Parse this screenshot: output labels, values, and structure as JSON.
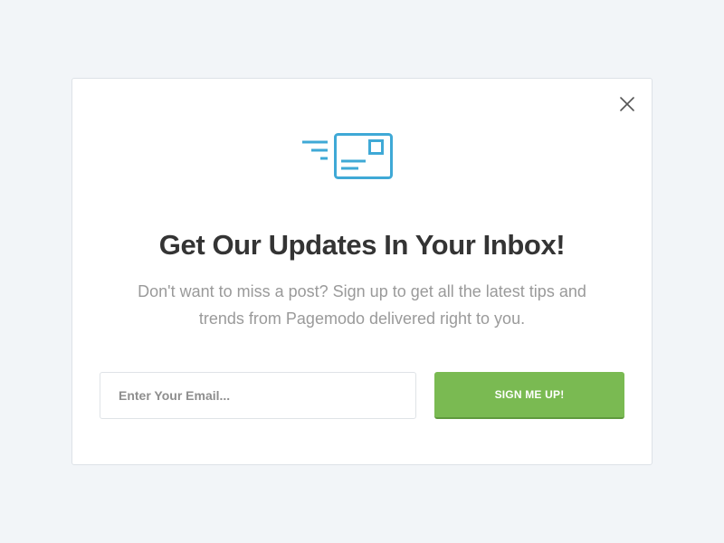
{
  "modal": {
    "title": "Get Our Updates In Your Inbox!",
    "subtitle": "Don't want to miss a post? Sign up to get all the latest tips and trends from Pagemodo delivered right to you.",
    "icon": "envelope-icon",
    "close_icon": "close-icon"
  },
  "form": {
    "email_placeholder": "Enter Your Email...",
    "email_value": "",
    "submit_label": "SIGN ME UP!"
  },
  "colors": {
    "background": "#f2f5f8",
    "accent_blue": "#3fa9d6",
    "button_green": "#7aba52",
    "title_text": "#343434",
    "subtitle_text": "#9a9a9a"
  }
}
